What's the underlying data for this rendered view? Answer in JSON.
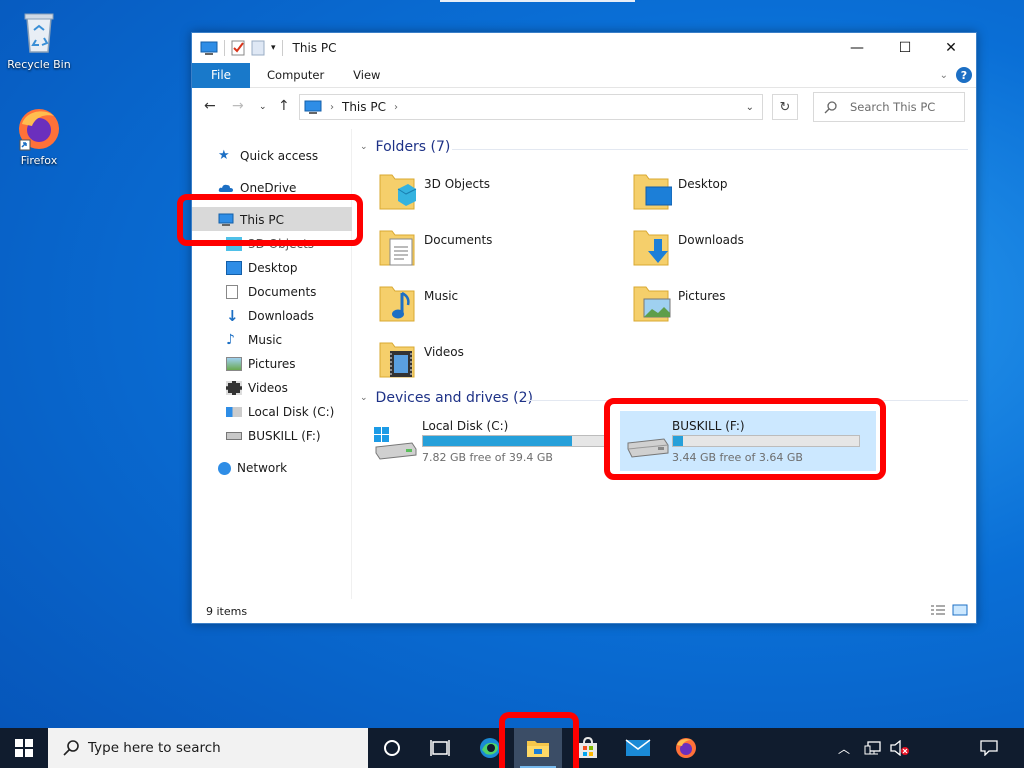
{
  "desktop": {
    "icons": [
      {
        "label": "Recycle Bin"
      },
      {
        "label": "Firefox"
      }
    ]
  },
  "window": {
    "title": "This PC",
    "controls": {
      "minimize": "—",
      "maximize": "☐",
      "close": "✕"
    },
    "ribbon": {
      "file": "File",
      "tabs": [
        "Computer",
        "View"
      ],
      "help": "?"
    },
    "address": {
      "location": "This PC",
      "search_placeholder": "Search This PC"
    },
    "nav_pane": {
      "quick_access": "Quick access",
      "onedrive": "OneDrive",
      "this_pc": "This PC",
      "children": [
        "3D Objects",
        "Desktop",
        "Documents",
        "Downloads",
        "Music",
        "Pictures",
        "Videos",
        "Local Disk (C:)",
        "BUSKILL (F:)"
      ],
      "network": "Network"
    },
    "folders_group": {
      "title": "Folders (7)"
    },
    "folders": [
      "3D Objects",
      "Desktop",
      "Documents",
      "Downloads",
      "Music",
      "Pictures",
      "Videos"
    ],
    "drives_group": {
      "title": "Devices and drives (2)"
    },
    "drives": [
      {
        "name": "Local Disk (C:)",
        "free_text": "7.82 GB free of 39.4 GB",
        "used_fraction": 0.8
      },
      {
        "name": "BUSKILL (F:)",
        "free_text": "3.44 GB free of 3.64 GB",
        "used_fraction": 0.055
      }
    ],
    "status": {
      "items": "9 items"
    }
  },
  "taskbar": {
    "search_placeholder": "Type here to search"
  },
  "colors": {
    "accent": "#1979ca",
    "highlight": "#ff0000",
    "drive_bar": "#26a0da",
    "taskbar": "#101c2e"
  }
}
